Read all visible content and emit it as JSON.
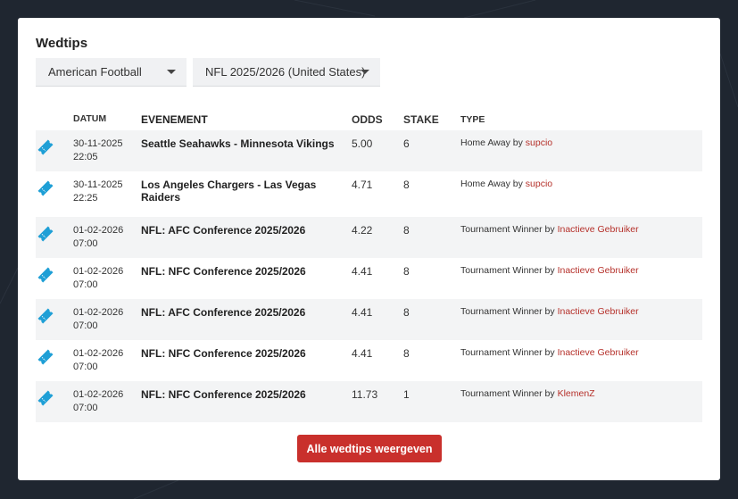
{
  "panel": {
    "title": "Wedtips"
  },
  "filters": {
    "sport": "American Football",
    "league": "NFL 2025/2026 (United States)"
  },
  "table": {
    "headers": [
      "DATUM",
      "EVENEMENT",
      "ODDS",
      "STAKE",
      "TYPE"
    ],
    "rows": [
      {
        "date": "30-11-2025",
        "time": "22:05",
        "event": "Seattle Seahawks - Minnesota Vikings",
        "odds": "5.00",
        "stake": "6",
        "type": "Home Away",
        "by": "by",
        "user": "supcio"
      },
      {
        "date": "30-11-2025",
        "time": "22:25",
        "event": "Los Angeles Chargers - Las Vegas Raiders",
        "odds": "4.71",
        "stake": "8",
        "type": "Home Away",
        "by": "by",
        "user": "supcio"
      },
      {
        "date": "01-02-2026",
        "time": "07:00",
        "event": "NFL: AFC Conference 2025/2026",
        "odds": "4.22",
        "stake": "8",
        "type": "Tournament Winner",
        "by": "by",
        "user": "Inactieve Gebruiker"
      },
      {
        "date": "01-02-2026",
        "time": "07:00",
        "event": "NFL: NFC Conference 2025/2026",
        "odds": "4.41",
        "stake": "8",
        "type": "Tournament Winner",
        "by": "by",
        "user": "Inactieve Gebruiker"
      },
      {
        "date": "01-02-2026",
        "time": "07:00",
        "event": "NFL: AFC Conference 2025/2026",
        "odds": "4.41",
        "stake": "8",
        "type": "Tournament Winner",
        "by": "by",
        "user": "Inactieve Gebruiker"
      },
      {
        "date": "01-02-2026",
        "time": "07:00",
        "event": "NFL: NFC Conference 2025/2026",
        "odds": "4.41",
        "stake": "8",
        "type": "Tournament Winner",
        "by": "by",
        "user": "Inactieve Gebruiker"
      },
      {
        "date": "01-02-2026",
        "time": "07:00",
        "event": "NFL: NFC Conference 2025/2026",
        "odds": "11.73",
        "stake": "1",
        "type": "Tournament Winner",
        "by": "by",
        "user": "KlemenZ"
      }
    ]
  },
  "actions": {
    "show_all": "Alle wedtips weergeven"
  },
  "icons": {
    "row_icon": "ticket-icon",
    "dropdown": "caret-down-icon"
  },
  "colors": {
    "accent": "#c9302c",
    "icon": "#1e9fd6",
    "user_link": "#b5302a"
  }
}
